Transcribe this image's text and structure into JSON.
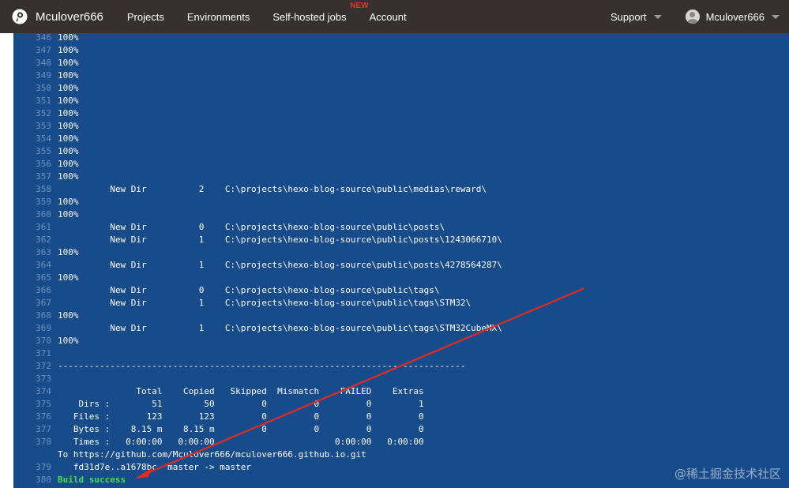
{
  "header": {
    "brand": "Mculover666",
    "nav": [
      {
        "label": "Projects"
      },
      {
        "label": "Environments"
      },
      {
        "label": "Self-hosted jobs",
        "badge": "NEW"
      },
      {
        "label": "Account"
      }
    ],
    "support_label": "Support",
    "user_label": "Mculover666",
    "colors": {
      "bar": "#36312f",
      "badge": "#e5342e"
    }
  },
  "console": {
    "background": "#174b8a",
    "success_color": "#3fe24a",
    "lines": [
      {
        "n": "346",
        "t": "100%"
      },
      {
        "n": "347",
        "t": "100%"
      },
      {
        "n": "348",
        "t": "100%"
      },
      {
        "n": "349",
        "t": "100%"
      },
      {
        "n": "350",
        "t": "100%"
      },
      {
        "n": "351",
        "t": "100%"
      },
      {
        "n": "352",
        "t": "100%"
      },
      {
        "n": "353",
        "t": "100%"
      },
      {
        "n": "354",
        "t": "100%"
      },
      {
        "n": "355",
        "t": "100%"
      },
      {
        "n": "356",
        "t": "100%"
      },
      {
        "n": "357",
        "t": "100%"
      },
      {
        "n": "358",
        "t": "          New Dir          2    C:\\projects\\hexo-blog-source\\public\\medias\\reward\\"
      },
      {
        "n": "359",
        "t": "100%"
      },
      {
        "n": "360",
        "t": "100%"
      },
      {
        "n": "361",
        "t": "          New Dir          0    C:\\projects\\hexo-blog-source\\public\\posts\\"
      },
      {
        "n": "362",
        "t": "          New Dir          1    C:\\projects\\hexo-blog-source\\public\\posts\\1243066710\\"
      },
      {
        "n": "363",
        "t": "100%"
      },
      {
        "n": "364",
        "t": "          New Dir          1    C:\\projects\\hexo-blog-source\\public\\posts\\4278564287\\"
      },
      {
        "n": "365",
        "t": "100%"
      },
      {
        "n": "366",
        "t": "          New Dir          0    C:\\projects\\hexo-blog-source\\public\\tags\\"
      },
      {
        "n": "367",
        "t": "          New Dir          1    C:\\projects\\hexo-blog-source\\public\\tags\\STM32\\"
      },
      {
        "n": "368",
        "t": "100%"
      },
      {
        "n": "369",
        "t": "          New Dir          1    C:\\projects\\hexo-blog-source\\public\\tags\\STM32CubeMX\\"
      },
      {
        "n": "370",
        "t": "100%"
      },
      {
        "n": "371",
        "t": ""
      },
      {
        "n": "372",
        "t": "------------------------------------------------------------------------------"
      },
      {
        "n": "373",
        "t": ""
      },
      {
        "n": "374",
        "t": "               Total    Copied   Skipped  Mismatch    FAILED    Extras"
      },
      {
        "n": "375",
        "t": "    Dirs :        51        50         0         0         0         1"
      },
      {
        "n": "376",
        "t": "   Files :       123       123         0         0         0         0"
      },
      {
        "n": "377",
        "t": "   Bytes :    8.15 m    8.15 m         0         0         0         0"
      },
      {
        "n": "378",
        "t": "   Times :   0:00:00   0:00:00                       0:00:00   0:00:00"
      },
      {
        "n": "",
        "t": "To https://github.com/Mculover666/mculover666.github.io.git"
      },
      {
        "n": "379",
        "t": "   fd31d7e..a1678bc  master -> master"
      },
      {
        "n": "380",
        "t": "Build success",
        "success": true
      }
    ]
  },
  "annotation": {
    "arrow_color": "#e02b25"
  },
  "watermark": "@稀土掘金技术社区"
}
